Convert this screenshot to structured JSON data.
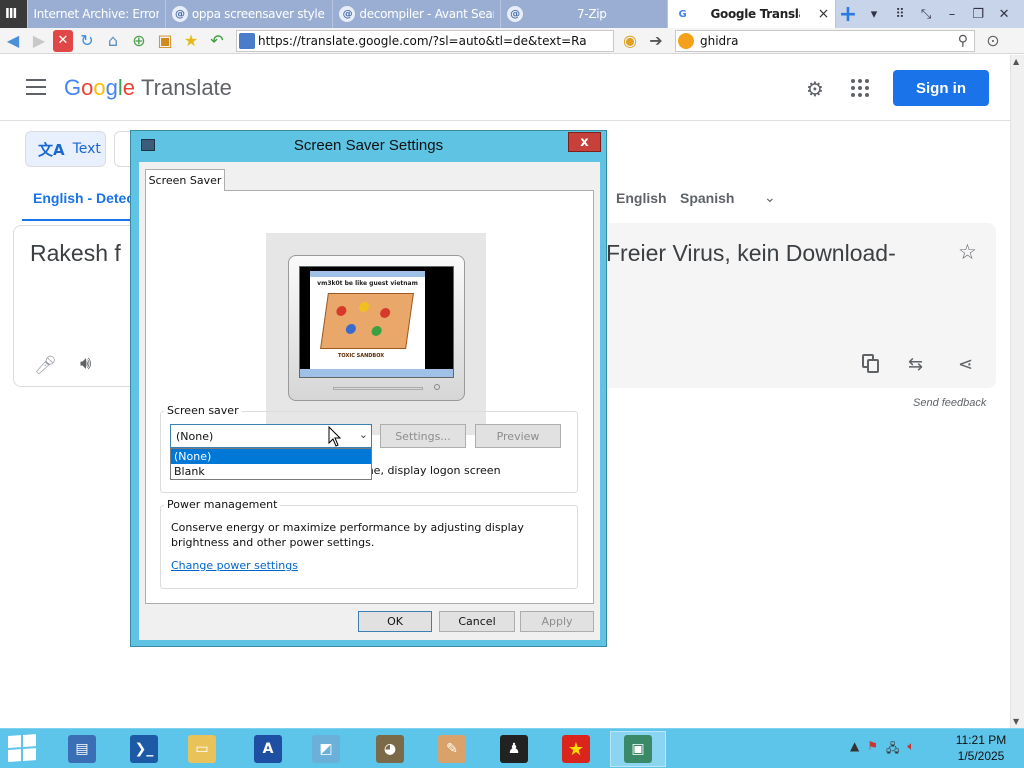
{
  "browser": {
    "tabs": [
      {
        "label": "Internet Archive: Error",
        "icon": "archive-icon"
      },
      {
        "label": "oppa screensaver style - A...",
        "icon": "search-engine-icon"
      },
      {
        "label": "decompiler - Avant Search...",
        "icon": "search-engine-icon"
      },
      {
        "label": "7-Zip",
        "icon": "search-engine-icon"
      },
      {
        "label": "Google Translate",
        "icon": "google-translate-icon",
        "active": true
      }
    ],
    "tab_close": "×",
    "address": "https://translate.google.com/?sl=auto&tl=de&text=Ra",
    "search_value": "ghidra"
  },
  "translate": {
    "logo_letters": [
      "G",
      "o",
      "o",
      "g",
      "l",
      "e"
    ],
    "product_name": "Translate",
    "sign_in": "Sign in",
    "mode_text": "Text",
    "source_lang": "English - Detec",
    "target_langs": [
      "English",
      "Spanish"
    ],
    "source_text": "Rakesh  f",
    "target_text": "Freier Virus, kein Download-",
    "send_feedback": "Send feedback"
  },
  "dialog": {
    "title": "Screen Saver Settings",
    "close": "x",
    "tab": "Screen Saver",
    "preview_caption": "vm3k0t be like guest vietnam",
    "preview_subcaption": "TOXIC SANDBOX",
    "screensaver_group": "Screen saver",
    "selected": "(None)",
    "options": [
      "(None)",
      "Blank"
    ],
    "settings_btn": "Settings...",
    "preview_btn": "Preview",
    "resume_text": "ume, display logon screen",
    "power_group": "Power management",
    "power_desc": "Conserve energy or maximize performance by adjusting display brightness and other power settings.",
    "power_link": "Change power settings",
    "ok": "OK",
    "cancel": "Cancel",
    "apply": "Apply"
  },
  "taskbar": {
    "time": "11:21 PM",
    "date": "1/5/2025"
  },
  "colors": {
    "google_blue": "#1a73e8",
    "dialog_frame": "#5fc3e3",
    "taskbar": "#5ec5ea",
    "close_red": "#c7403a"
  }
}
